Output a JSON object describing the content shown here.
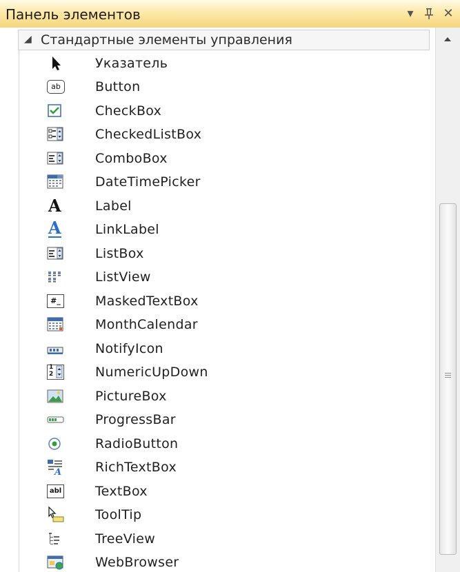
{
  "panel": {
    "title": "Панель элементов",
    "dropdown_glyph": "▾",
    "pin_glyph": "ᵖ",
    "close_glyph": "✕"
  },
  "group": {
    "collapse_glyph": "◢",
    "label": "Стандартные элементы управления"
  },
  "items": [
    {
      "label": "Указатель",
      "icon": "pointer-icon"
    },
    {
      "label": "Button",
      "icon": "button-icon"
    },
    {
      "label": "CheckBox",
      "icon": "checkbox-icon"
    },
    {
      "label": "CheckedListBox",
      "icon": "checkedlistbox-icon"
    },
    {
      "label": "ComboBox",
      "icon": "combobox-icon"
    },
    {
      "label": "DateTimePicker",
      "icon": "datetimepicker-icon"
    },
    {
      "label": "Label",
      "icon": "label-icon"
    },
    {
      "label": "LinkLabel",
      "icon": "linklabel-icon"
    },
    {
      "label": "ListBox",
      "icon": "listbox-icon"
    },
    {
      "label": "ListView",
      "icon": "listview-icon"
    },
    {
      "label": "MaskedTextBox",
      "icon": "maskedtextbox-icon"
    },
    {
      "label": "MonthCalendar",
      "icon": "monthcalendar-icon"
    },
    {
      "label": "NotifyIcon",
      "icon": "notifyicon-icon"
    },
    {
      "label": "NumericUpDown",
      "icon": "numericupdown-icon"
    },
    {
      "label": "PictureBox",
      "icon": "picturebox-icon"
    },
    {
      "label": "ProgressBar",
      "icon": "progressbar-icon"
    },
    {
      "label": "RadioButton",
      "icon": "radiobutton-icon"
    },
    {
      "label": "RichTextBox",
      "icon": "richtextbox-icon"
    },
    {
      "label": "TextBox",
      "icon": "textbox-icon"
    },
    {
      "label": "ToolTip",
      "icon": "tooltip-icon"
    },
    {
      "label": "TreeView",
      "icon": "treeview-icon"
    },
    {
      "label": "WebBrowser",
      "icon": "webbrowser-icon"
    }
  ],
  "icon_text": {
    "button": "ab",
    "label": "A",
    "textbox": "abl",
    "masked": "#_",
    "numeric_top": "1",
    "numeric_bottom": "2"
  },
  "colors": {
    "titlebar": "#f7dc8c",
    "accent_blue": "#2a6fc9",
    "check_green": "#2e9e3e"
  }
}
